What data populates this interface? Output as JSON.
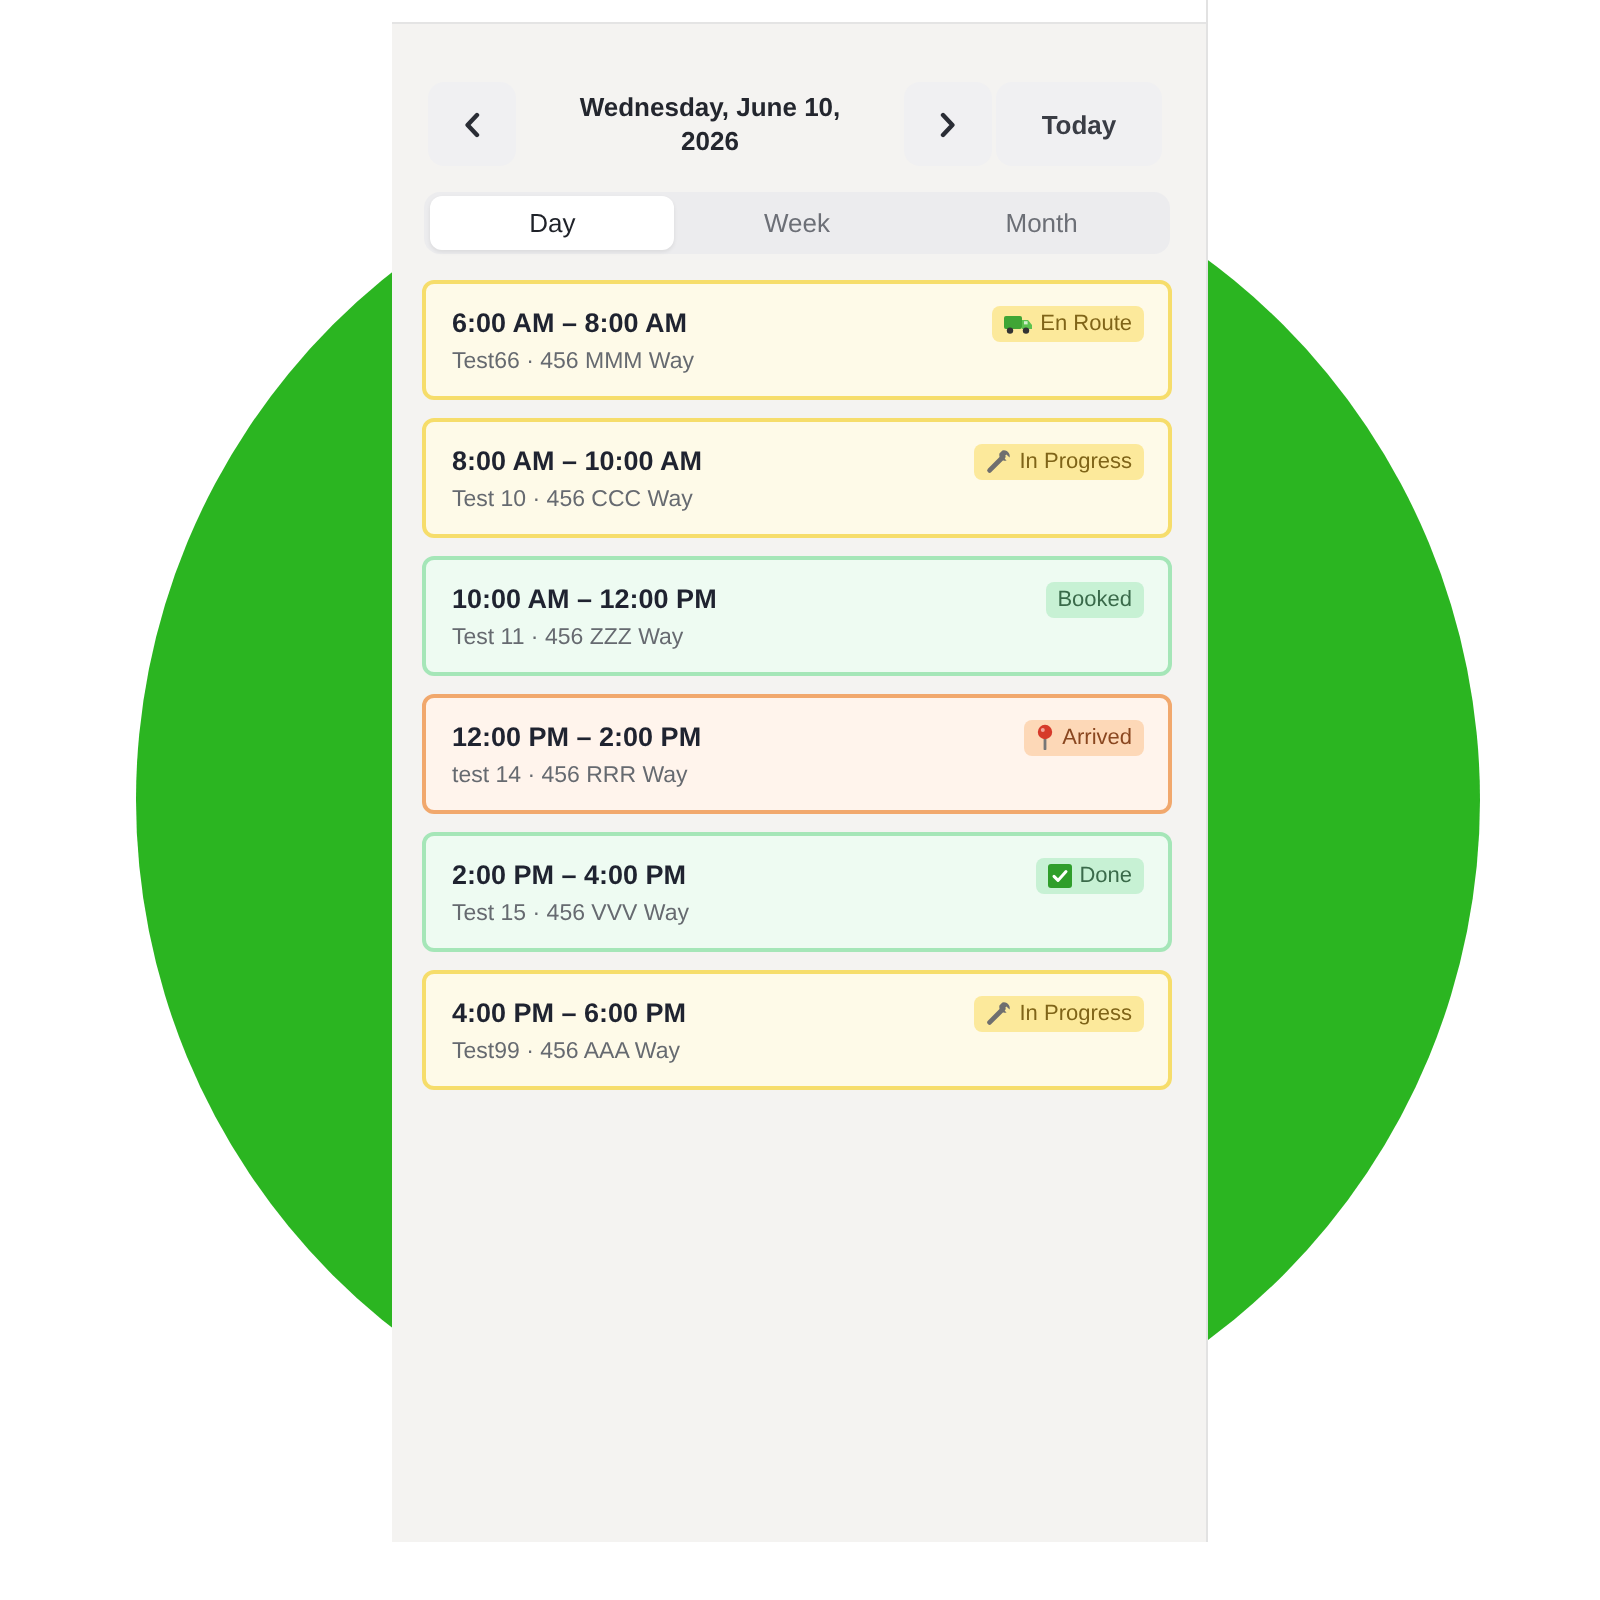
{
  "date_nav": {
    "title": "Wednesday, June 10, 2026",
    "today_button": "Today"
  },
  "tabs": [
    {
      "label": "Day",
      "selected": true
    },
    {
      "label": "Week",
      "selected": false
    },
    {
      "label": "Month",
      "selected": false
    }
  ],
  "appointments": [
    {
      "time": "6:00 AM – 8:00 AM",
      "details": "Test66 · 456 MMM Way",
      "status": {
        "kind": "en_route",
        "label": "En Route"
      }
    },
    {
      "time": "8:00 AM – 10:00 AM",
      "details": "Test 10 · 456 CCC Way",
      "status": {
        "kind": "in_progress",
        "label": "In Progress"
      }
    },
    {
      "time": "10:00 AM – 12:00 PM",
      "details": "Test 11 · 456 ZZZ Way",
      "status": {
        "kind": "booked",
        "label": "Booked"
      }
    },
    {
      "time": "12:00 PM – 2:00 PM",
      "details": "test 14 · 456 RRR Way",
      "status": {
        "kind": "arrived",
        "label": "Arrived"
      }
    },
    {
      "time": "2:00 PM – 4:00 PM",
      "details": "Test 15 · 456 VVV Way",
      "status": {
        "kind": "done",
        "label": "Done"
      }
    },
    {
      "time": "4:00 PM – 6:00 PM",
      "details": "Test99 · 456 AAA Way",
      "status": {
        "kind": "in_progress",
        "label": "In Progress"
      }
    }
  ]
}
